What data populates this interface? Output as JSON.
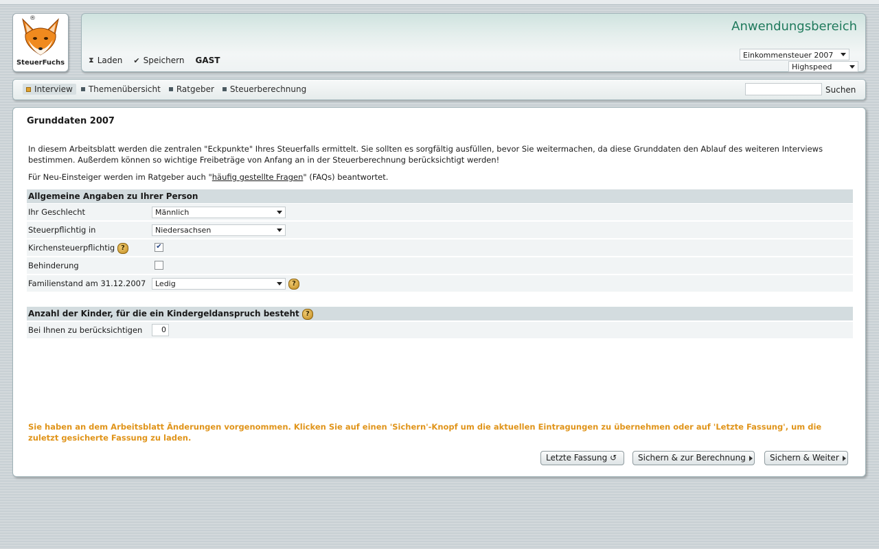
{
  "brand": {
    "name": "SteuerFuchs",
    "registered": "®"
  },
  "header": {
    "title": "Anwendungsbereich",
    "actions": [
      {
        "label": "Laden",
        "icon": "load-icon"
      },
      {
        "label": "Speichern",
        "icon": "check-icon"
      }
    ],
    "user": "GAST",
    "year_select": "Einkommensteuer 2007",
    "mode_select": "Highspeed"
  },
  "nav": {
    "tabs": [
      {
        "label": "Interview",
        "active": true
      },
      {
        "label": "Themenübersicht"
      },
      {
        "label": "Ratgeber"
      },
      {
        "label": "Steuerberechnung"
      }
    ],
    "search_label": "Suchen",
    "search_value": ""
  },
  "main": {
    "title": "Grunddaten 2007",
    "intro": "In diesem Arbeitsblatt werden die zentralen \"Eckpunkte\" Ihres Steuerfalls ermittelt. Sie sollten es sorgfältig ausfüllen, bevor Sie weitermachen, da diese Grunddaten den Ablauf des weiteren Interviews bestimmen. Außerdem können so wichtige Freibeträge von Anfang an in der Steuerberechnung berücksichtigt werden!",
    "faq_prefix": "Für Neu-Einsteiger werden im Ratgeber auch \"",
    "faq_link": "häufig gestellte Fragen",
    "faq_suffix": "\" (FAQs) beantwortet.",
    "section1": {
      "heading": "Allgemeine Angaben zu Ihrer Person",
      "gender": {
        "label": "Ihr Geschlecht",
        "value": "Männlich"
      },
      "state": {
        "label": "Steuerpflichtig in",
        "value": "Niedersachsen"
      },
      "church": {
        "label": "Kirchensteuerpflichtig",
        "checked": true
      },
      "disability": {
        "label": "Behinderung",
        "checked": false
      },
      "marital": {
        "label": "Familienstand am 31.12.2007",
        "value": "Ledig"
      }
    },
    "section2": {
      "heading": "Anzahl der Kinder, für die ein Kindergeldanspruch besteht",
      "children": {
        "label": "Bei Ihnen zu berücksichtigen",
        "value": "0"
      }
    },
    "notice": "Sie haben an dem Arbeitsblatt Änderungen vorgenommen. Klicken Sie auf einen 'Sichern'-Knopf um die aktuellen Eintragungen zu übernehmen oder auf 'Letzte Fassung', um die zuletzt gesicherte Fassung zu laden.",
    "buttons": {
      "last_version": "Letzte Fassung",
      "save_calc": "Sichern & zur Berechnung",
      "save_next": "Sichern & Weiter"
    }
  },
  "colors": {
    "accent_green": "#1f7a5c",
    "notice_orange": "#e0941a",
    "section_bg": "#d3dcdf"
  }
}
